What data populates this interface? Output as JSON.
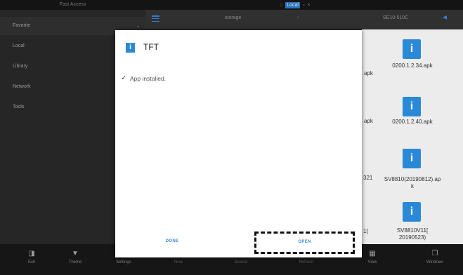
{
  "status": {
    "fast_access": "Fast Access",
    "local_badge": "Local"
  },
  "sidebar": {
    "items": [
      {
        "label": "Favorite"
      },
      {
        "label": "Local"
      },
      {
        "label": "Library"
      },
      {
        "label": "Network"
      },
      {
        "label": "Tools"
      }
    ]
  },
  "toolbar": {
    "storage": "storage",
    "device": "SE10-510C"
  },
  "files": [
    {
      "name": "0200.1.2.34.apk",
      "partial": "apk"
    },
    {
      "name": "0200.1.2.40.apk",
      "partial": "apk"
    },
    {
      "name_line1": "SV8810(20190812).ap",
      "name_line2": "k",
      "partial": "321"
    },
    {
      "name_line1": "SV8810V11[",
      "name_line2": "20190523)",
      "partial": "1["
    }
  ],
  "bottom_bar": [
    {
      "label": "Exit"
    },
    {
      "label": "Theme"
    },
    {
      "label": "Settings"
    },
    {
      "label": "New"
    },
    {
      "label": "Search"
    },
    {
      "label": "Refresh"
    },
    {
      "label": "View"
    },
    {
      "label": "Windows"
    }
  ],
  "dialog": {
    "app_name": "TFT",
    "message": "App installed.",
    "done_label": "DONE",
    "open_label": "OPEN"
  },
  "colors": {
    "accent": "#2a89d6",
    "button_text": "#3a8ed6",
    "dialog_bg": "#ffffff"
  }
}
